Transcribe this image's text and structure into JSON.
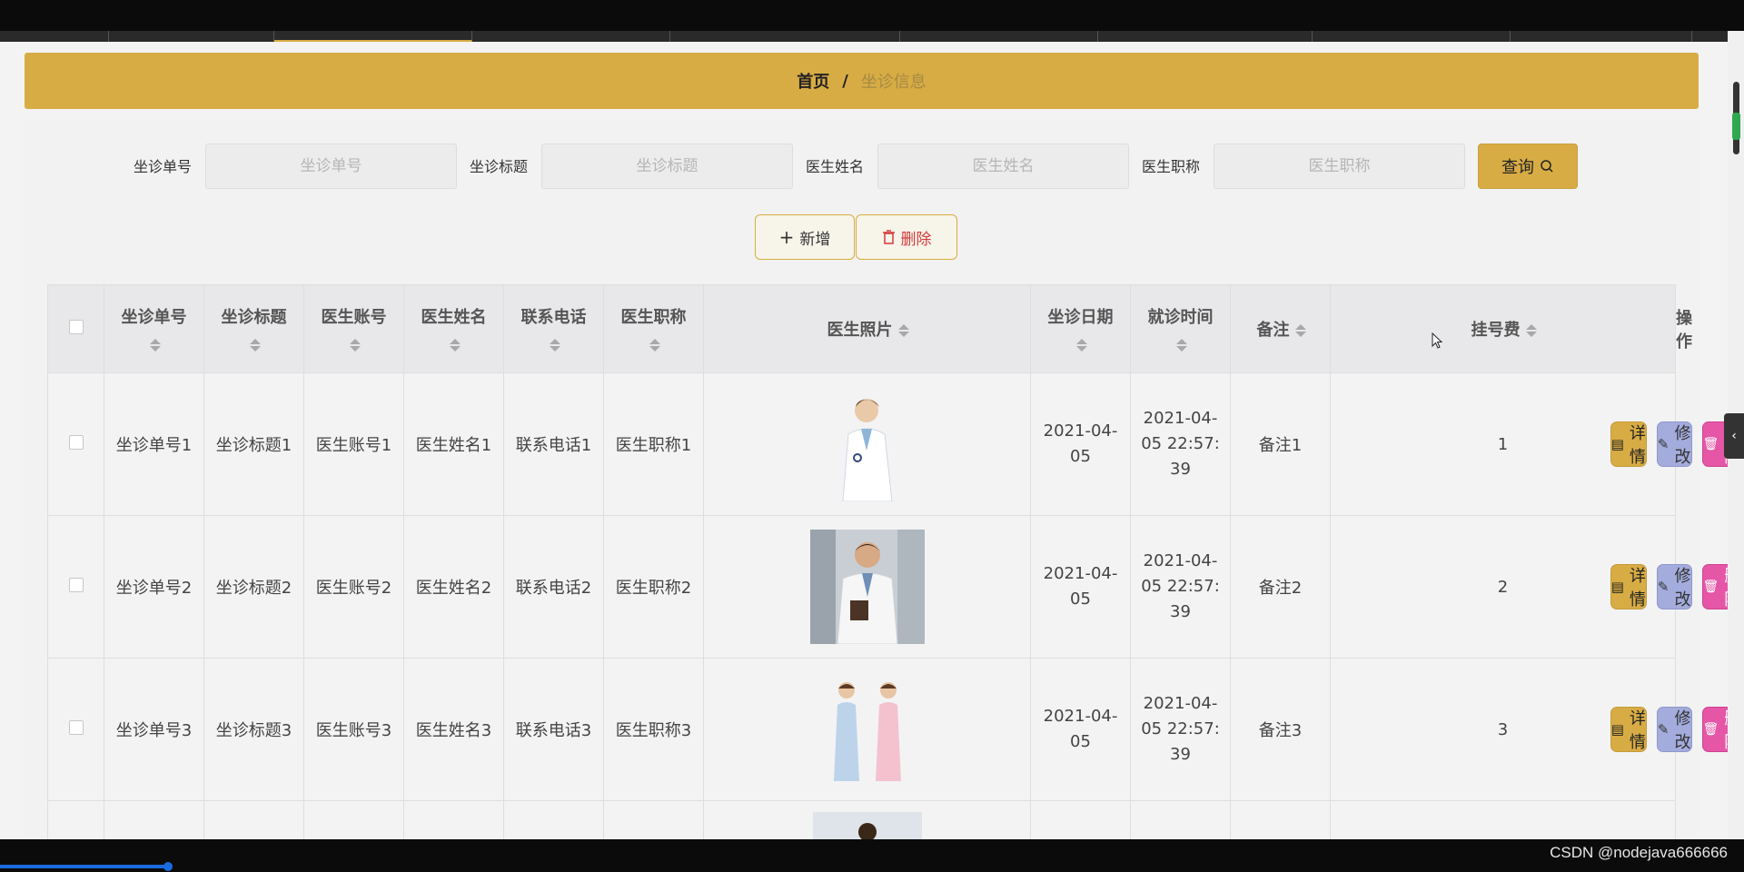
{
  "breadcrumb": {
    "home": "首页",
    "separator": "/",
    "current": "坐诊信息"
  },
  "search": {
    "fields": [
      {
        "label": "坐诊单号",
        "placeholder": "坐诊单号"
      },
      {
        "label": "坐诊标题",
        "placeholder": "坐诊标题"
      },
      {
        "label": "医生姓名",
        "placeholder": "医生姓名"
      },
      {
        "label": "医生职称",
        "placeholder": "医生职称"
      }
    ],
    "query_label": "查询"
  },
  "toolbar": {
    "add_label": "新增",
    "delete_label": "删除"
  },
  "table": {
    "headers": [
      "坐诊单号",
      "坐诊标题",
      "医生账号",
      "医生姓名",
      "联系电话",
      "医生职称",
      "医生照片",
      "坐诊日期",
      "就诊时间",
      "备注",
      "挂号费",
      "操作"
    ],
    "rows": [
      {
        "no": "坐诊单号1",
        "title": "坐诊标题1",
        "account": "医生账号1",
        "name": "医生姓名1",
        "phone": "联系电话1",
        "rank": "医生职称1",
        "photo": "doctor-woman-photo",
        "date": "2021-04-05",
        "time_a": "2021-04-",
        "time_b": "05 22:57:",
        "time_c": "39",
        "note": "备注1",
        "fee": "1"
      },
      {
        "no": "坐诊单号2",
        "title": "坐诊标题2",
        "account": "医生账号2",
        "name": "医生姓名2",
        "phone": "联系电话2",
        "rank": "医生职称2",
        "photo": "doctor-man-photo",
        "date": "2021-04-05",
        "time_a": "2021-04-",
        "time_b": "05 22:57:",
        "time_c": "39",
        "note": "备注2",
        "fee": "2"
      },
      {
        "no": "坐诊单号3",
        "title": "坐诊标题3",
        "account": "医生账号3",
        "name": "医生姓名3",
        "phone": "联系电话3",
        "rank": "医生职称3",
        "photo": "nurses-photo",
        "date": "2021-04-05",
        "time_a": "2021-04-",
        "time_b": "05 22:57:",
        "time_c": "39",
        "note": "备注3",
        "fee": "3"
      }
    ],
    "actions": {
      "detail": "详情",
      "edit": "修改",
      "delete": "删除"
    }
  },
  "watermark": "CSDN @nodejava666666",
  "colors": {
    "accent": "#d8ac44",
    "edit": "#a3acdc",
    "danger": "#e656a6"
  }
}
